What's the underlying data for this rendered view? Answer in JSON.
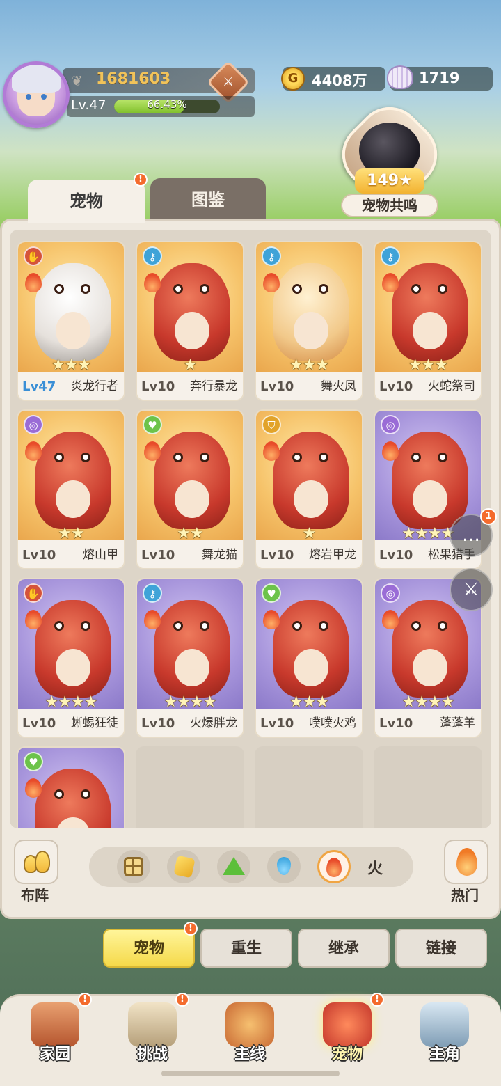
{
  "player": {
    "power": "1681603",
    "level": "Lv.47",
    "exp_percent": "66.43%",
    "exp_fraction": 0.6643
  },
  "currency": {
    "gold": "4408万",
    "pearls": "1719"
  },
  "resonance": {
    "value": "149",
    "label": "宠物共鸣"
  },
  "tabs": {
    "pets": "宠物",
    "dex": "图鉴"
  },
  "pets": [
    {
      "level": "Lv47",
      "name": "炎龙行者",
      "stars": "★★★",
      "type_icon": "claw-icon",
      "type_color": "red",
      "bg": "gold"
    },
    {
      "level": "Lv10",
      "name": "奔行暴龙",
      "stars": "★",
      "type_icon": "key-icon",
      "type_color": "blue",
      "bg": "gold"
    },
    {
      "level": "Lv10",
      "name": "舞火凤",
      "stars": "★★★",
      "type_icon": "key-icon",
      "type_color": "blue",
      "bg": "gold"
    },
    {
      "level": "Lv10",
      "name": "火蛇祭司",
      "stars": "★★★",
      "type_icon": "key-icon",
      "type_color": "blue",
      "bg": "gold"
    },
    {
      "level": "Lv10",
      "name": "熔山甲",
      "stars": "★★",
      "type_icon": "swirl-icon",
      "type_color": "violet",
      "bg": "gold"
    },
    {
      "level": "Lv10",
      "name": "舞龙猫",
      "stars": "★★",
      "type_icon": "heart-icon",
      "type_color": "green",
      "bg": "gold"
    },
    {
      "level": "Lv10",
      "name": "熔岩甲龙",
      "stars": "★",
      "type_icon": "shield-icon",
      "type_color": "yellow",
      "bg": "gold"
    },
    {
      "level": "Lv10",
      "name": "松果猎手",
      "stars": "★★★★",
      "type_icon": "swirl-icon",
      "type_color": "violet",
      "bg": "purple"
    },
    {
      "level": "Lv10",
      "name": "蜥蜴狂徒",
      "stars": "★★★★",
      "type_icon": "claw-icon",
      "type_color": "red",
      "bg": "purple"
    },
    {
      "level": "Lv10",
      "name": "火爆胖龙",
      "stars": "★★★★",
      "type_icon": "key-icon",
      "type_color": "blue",
      "bg": "purple"
    },
    {
      "level": "Lv10",
      "name": "噗噗火鸡",
      "stars": "★★★",
      "type_icon": "heart-icon",
      "type_color": "green",
      "bg": "purple"
    },
    {
      "level": "Lv10",
      "name": "蓬蓬羊",
      "stars": "★★★★",
      "type_icon": "swirl-icon",
      "type_color": "violet",
      "bg": "purple"
    },
    {
      "level": "",
      "name": "",
      "stars": "",
      "type_icon": "heart-icon",
      "type_color": "green",
      "bg": "purple"
    }
  ],
  "chat_badge": "1",
  "filters": {
    "formation_label": "布阵",
    "selected_element": "火",
    "hot_label": "热门",
    "elements": [
      "all-grid-icon",
      "earth-icon",
      "grass-icon",
      "water-icon",
      "fire-icon"
    ]
  },
  "sub_tabs": [
    "宠物",
    "重生",
    "继承",
    "链接"
  ],
  "nav": [
    {
      "label": "家园",
      "icon": "home-meat-icon"
    },
    {
      "label": "挑战",
      "icon": "challenge-icon"
    },
    {
      "label": "主线",
      "icon": "mainline-icon"
    },
    {
      "label": "宠物",
      "icon": "pet-icon"
    },
    {
      "label": "主角",
      "icon": "hero-icon"
    }
  ],
  "colors": {
    "accent_gold": "#f1c35a",
    "badge_orange": "#f46b2d",
    "active_tab_yellow": "#f5d94a"
  }
}
